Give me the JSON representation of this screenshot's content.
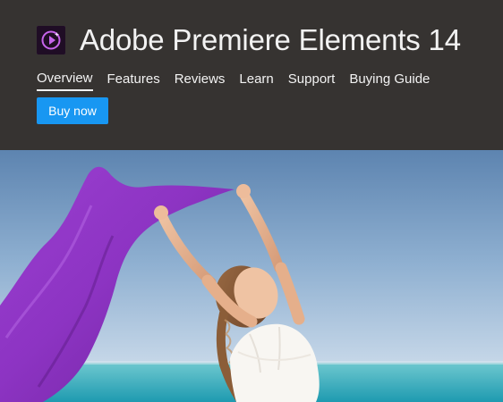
{
  "header": {
    "app_title": "Adobe Premiere Elements 14",
    "logo_icon": "premiere-elements-logo-icon"
  },
  "nav": {
    "items": [
      {
        "label": "Overview",
        "active": true
      },
      {
        "label": "Features",
        "active": false
      },
      {
        "label": "Reviews",
        "active": false
      },
      {
        "label": "Learn",
        "active": false
      },
      {
        "label": "Support",
        "active": false
      },
      {
        "label": "Buying Guide",
        "active": false
      }
    ]
  },
  "cta": {
    "buy_label": "Buy now"
  },
  "colors": {
    "header_bg": "#363331",
    "accent_blue": "#1897f2",
    "brand_purple": "#8e2fbc"
  }
}
